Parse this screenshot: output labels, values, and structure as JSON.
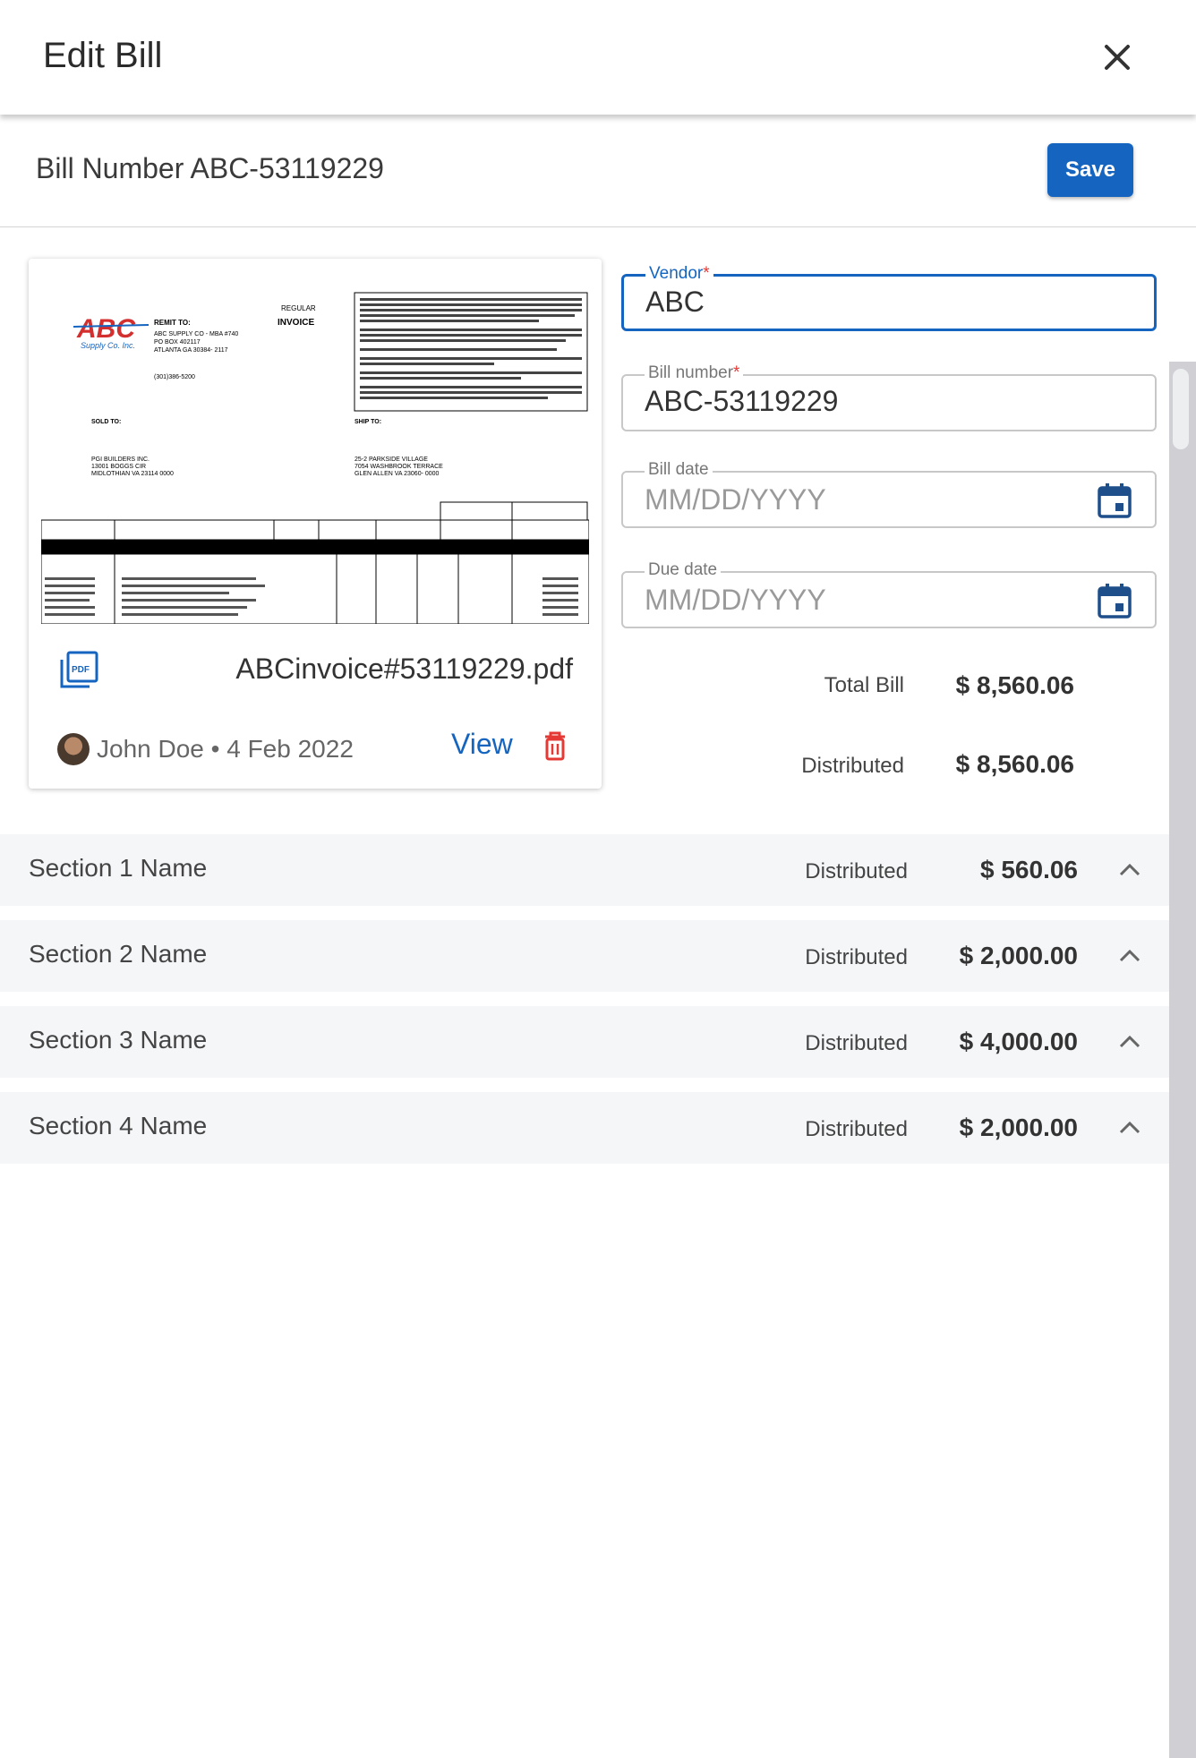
{
  "header": {
    "title": "Edit Bill",
    "close_icon": "close-icon"
  },
  "bill_bar": {
    "title": "Bill Number ABC-53119229",
    "save_label": "Save"
  },
  "document": {
    "filename": "ABCinvoice#53119229.pdf",
    "uploader": "John Doe • 4 Feb 2022",
    "view_label": "View",
    "pdf_icon": "pdf-icon",
    "trash_icon": "trash-icon"
  },
  "invoice_preview": {
    "logo_text": "ABC",
    "logo_sub": "Supply Co. Inc.",
    "remit_to_label": "REMIT TO:",
    "remit_lines": [
      "ABC SUPPLY CO - MBA #740",
      "PO BOX 402117",
      "ATLANTA GA 30384- 2117"
    ],
    "phone": "(301)386-5200",
    "regular": "REGULAR",
    "invoice": "INVOICE",
    "sold_to_label": "SOLD TO:",
    "ship_to_label": "SHIP TO:",
    "sold_lines": [
      "PGI BUILDERS INC.",
      "13001 BOGGS CIR",
      "MIDLOTHIAN VA 23114 0000"
    ],
    "ship_lines": [
      "25-2 PARKSIDE VILLAGE",
      "7054 WASHBROOK TERRACE",
      "GLEN ALLEN VA 23060- 0000"
    ]
  },
  "form": {
    "vendor": {
      "label": "Vendor",
      "value": "ABC"
    },
    "bill_number": {
      "label": "Bill number",
      "value": "ABC-53119229"
    },
    "bill_date": {
      "label": "Bill date",
      "placeholder": "MM/DD/YYYY"
    },
    "due_date": {
      "label": "Due date",
      "placeholder": "MM/DD/YYYY"
    },
    "required_mark": "*"
  },
  "totals": {
    "total_label": "Total Bill",
    "total_value": "$ 8,560.06",
    "distributed_label": "Distributed",
    "distributed_value": "$ 8,560.06"
  },
  "sections": [
    {
      "name": "Section 1 Name",
      "dist_label": "Distributed",
      "amount": "$ 560.06"
    },
    {
      "name": "Section 2 Name",
      "dist_label": "Distributed",
      "amount": "$ 2,000.00"
    },
    {
      "name": "Section 3 Name",
      "dist_label": "Distributed",
      "amount": "$ 4,000.00"
    },
    {
      "name": "Section 4 Name",
      "dist_label": "Distributed",
      "amount": "$ 2,000.00"
    }
  ],
  "colors": {
    "accent": "#1565c0",
    "danger": "#e53935",
    "section_bg": "#f5f6f8"
  }
}
